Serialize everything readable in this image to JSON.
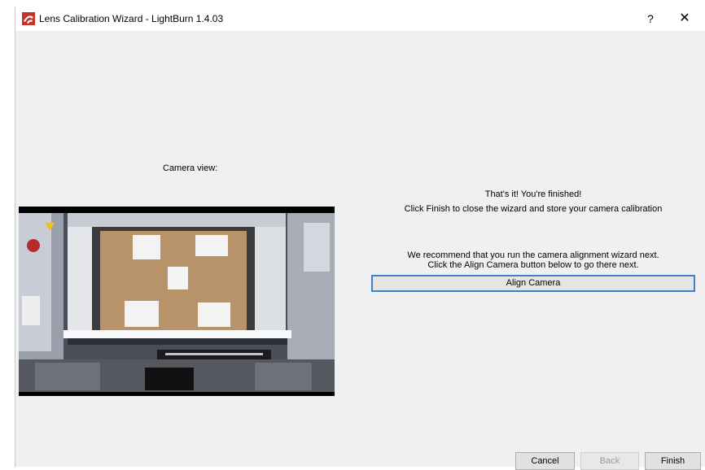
{
  "window": {
    "title": "Lens Calibration Wizard - LightBurn 1.4.03",
    "help_label": "?",
    "close_label": "✕"
  },
  "camera": {
    "label": "Camera view:"
  },
  "messages": {
    "finished_heading": "That's it!  You're finished!",
    "finished_detail": "Click Finish to close the wizard and store your camera calibration",
    "recommend_line1": "We recommend that you run the camera alignment wizard next.",
    "recommend_line2": "Click the Align Camera button below to go there next."
  },
  "buttons": {
    "align_camera": "Align Camera",
    "cancel": "Cancel",
    "back": "Back",
    "finish": "Finish"
  },
  "icons": {
    "app": "lightburn-app-icon",
    "help": "help-icon",
    "close": "close-icon"
  }
}
